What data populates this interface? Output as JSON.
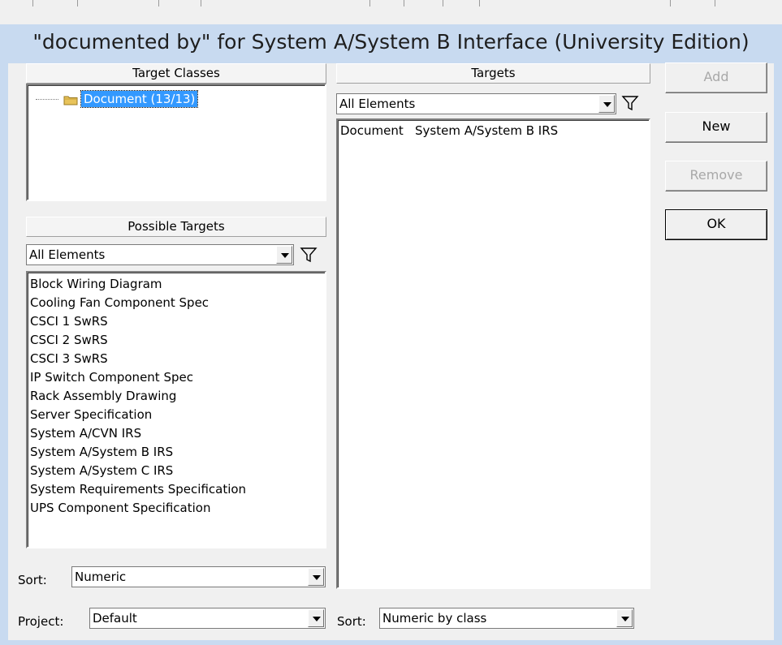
{
  "dialog": {
    "title": "\"documented by\" for System A/System B Interface (University Edition)"
  },
  "target_classes": {
    "header": "Target Classes",
    "tree_item": "Document (13/13)"
  },
  "possible_targets": {
    "header": "Possible Targets",
    "filter_value": "All Elements",
    "items": [
      "Block Wiring Diagram",
      "Cooling Fan Component Spec",
      "CSCI 1 SwRS",
      "CSCI 2 SwRS",
      "CSCI 3 SwRS",
      "IP Switch Component Spec",
      "Rack Assembly Drawing",
      "Server Specification",
      "System A/CVN IRS",
      "System A/System B IRS",
      "System A/System C IRS",
      "System Requirements Specification",
      "UPS Component Specification"
    ],
    "sort_label": "Sort:",
    "sort_value": "Numeric",
    "project_label": "Project:",
    "project_value": "Default"
  },
  "targets": {
    "header": "Targets",
    "filter_value": "All Elements",
    "rows": [
      {
        "class": "Document",
        "name": "System A/System B IRS"
      }
    ],
    "sort_label": "Sort:",
    "sort_value": "Numeric by class"
  },
  "buttons": {
    "add": "Add",
    "new": "New",
    "remove": "Remove",
    "ok": "OK"
  },
  "icons": {
    "filter": "funnel-icon",
    "folder": "folder-icon",
    "dropdown": "chevron-down-icon"
  }
}
